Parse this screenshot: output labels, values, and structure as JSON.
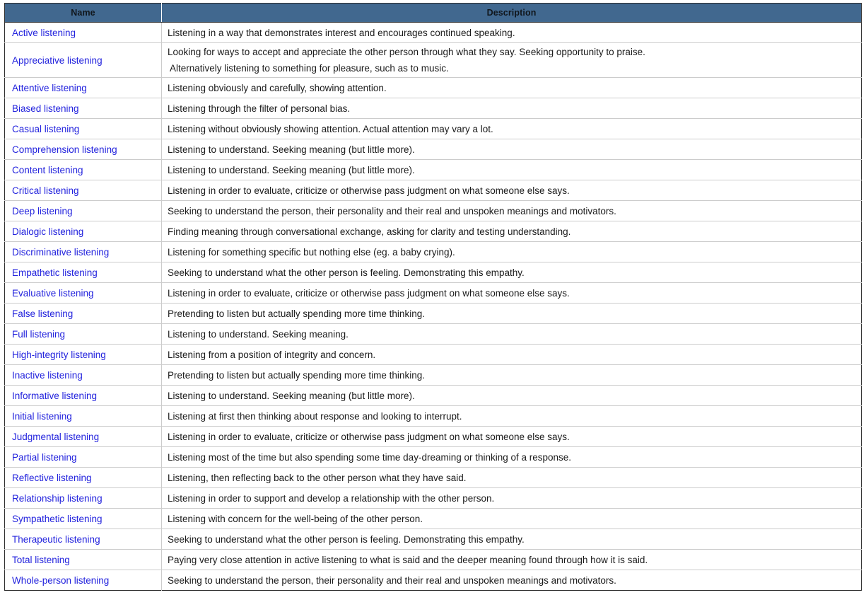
{
  "table": {
    "columns": [
      {
        "key": "name",
        "label": "Name"
      },
      {
        "key": "description",
        "label": "Description"
      }
    ],
    "rows": [
      {
        "name": "Active listening",
        "lines": [
          "Listening in a way that demonstrates interest and encourages continued speaking."
        ]
      },
      {
        "name": "Appreciative listening",
        "lines": [
          "Looking for ways to accept and appreciate the other person through what they say. Seeking opportunity to praise.",
          " Alternatively listening to something for pleasure, such as to music."
        ]
      },
      {
        "name": "Attentive listening",
        "lines": [
          "Listening obviously and carefully, showing attention."
        ]
      },
      {
        "name": "Biased listening",
        "lines": [
          "Listening through the filter of personal bias."
        ]
      },
      {
        "name": "Casual listening",
        "lines": [
          "Listening without obviously showing attention. Actual attention may vary a lot."
        ]
      },
      {
        "name": "Comprehension listening",
        "lines": [
          "Listening to understand. Seeking meaning (but little more)."
        ]
      },
      {
        "name": "Content listening",
        "lines": [
          "Listening to understand. Seeking meaning (but little more)."
        ]
      },
      {
        "name": "Critical listening",
        "lines": [
          "Listening in order to evaluate, criticize or otherwise pass judgment on what someone else says."
        ]
      },
      {
        "name": "Deep listening",
        "lines": [
          "Seeking to understand the person, their personality and their real and unspoken meanings and motivators."
        ]
      },
      {
        "name": "Dialogic listening",
        "lines": [
          "Finding meaning through conversational exchange, asking for clarity and testing understanding."
        ]
      },
      {
        "name": "Discriminative listening",
        "lines": [
          "Listening for something specific but nothing else (eg. a baby crying)."
        ]
      },
      {
        "name": "Empathetic listening",
        "lines": [
          "Seeking to understand what the other person is feeling. Demonstrating this empathy."
        ]
      },
      {
        "name": "Evaluative listening",
        "lines": [
          "Listening in order to evaluate, criticize or otherwise pass judgment on what someone else says."
        ]
      },
      {
        "name": "False listening",
        "lines": [
          "Pretending to listen but actually spending more time thinking."
        ]
      },
      {
        "name": "Full listening",
        "lines": [
          "Listening to understand. Seeking meaning."
        ]
      },
      {
        "name": "High-integrity listening",
        "lines": [
          "Listening from a position of integrity and concern."
        ]
      },
      {
        "name": "Inactive listening",
        "lines": [
          "Pretending to listen but actually spending more time thinking."
        ]
      },
      {
        "name": "Informative listening",
        "lines": [
          "Listening to understand. Seeking meaning (but little more)."
        ]
      },
      {
        "name": "Initial listening",
        "lines": [
          "Listening at first then thinking about response and looking to interrupt."
        ]
      },
      {
        "name": "Judgmental listening",
        "lines": [
          "Listening in order to evaluate, criticize or otherwise pass judgment on what someone else says."
        ]
      },
      {
        "name": "Partial listening",
        "lines": [
          "Listening most of the time but also spending some time day-dreaming or thinking of a response."
        ]
      },
      {
        "name": "Reflective listening",
        "lines": [
          "Listening, then reflecting back to the other person what they have said."
        ]
      },
      {
        "name": "Relationship listening",
        "lines": [
          "Listening in order to support and develop a relationship with the other person."
        ]
      },
      {
        "name": "Sympathetic listening",
        "lines": [
          "Listening with concern for the well-being of the other person."
        ]
      },
      {
        "name": "Therapeutic listening",
        "lines": [
          "Seeking to understand what the other person is feeling. Demonstrating this empathy."
        ]
      },
      {
        "name": "Total listening",
        "lines": [
          "Paying very close attention in active listening to what is said and the deeper meaning found through how it is said."
        ]
      },
      {
        "name": "Whole-person listening",
        "lines": [
          "Seeking to understand the person, their personality and their real and unspoken meanings and motivators."
        ]
      }
    ]
  },
  "colors": {
    "header_background": "#41688f",
    "header_text": "#10161c",
    "link_text": "#2222dd",
    "body_text": "#1a1a1a",
    "row_border": "#cccccc",
    "table_border": "#2d2d2d",
    "page_background": "#ffffff"
  }
}
